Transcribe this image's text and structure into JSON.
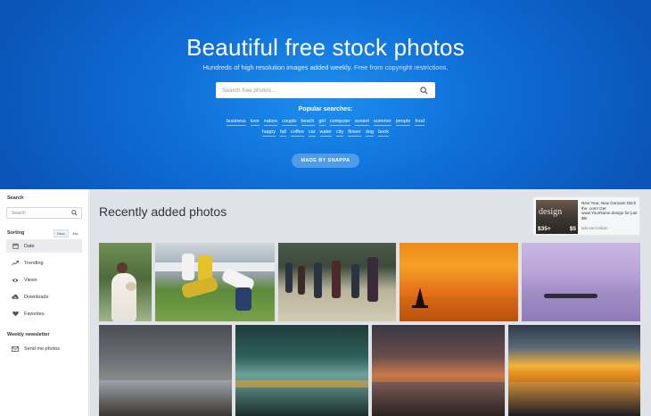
{
  "hero": {
    "title": "Beautiful free stock photos",
    "subtitle_text": "Hundreds of high resolution images added weekly. ",
    "subtitle_link": "Free from copyright restrictions.",
    "search_placeholder": "Search free photos...",
    "popular_title": "Popular searches:",
    "popular_row1": [
      "business",
      "love",
      "nature",
      "couple",
      "beach",
      "girl",
      "computer",
      "sunset",
      "summer",
      "people",
      "food"
    ],
    "popular_row2": [
      "happy",
      "fall",
      "coffee",
      "car",
      "water",
      "city",
      "flower",
      "dog",
      "book"
    ],
    "button_label": "MADE BY SNAPPA",
    "bg_color": "#0f6fd8"
  },
  "sidebar": {
    "search_title": "Search",
    "search_placeholder": "Search",
    "sorting_title": "Sorting",
    "sort_desc": "Desc",
    "sort_asc": "Asc",
    "items": [
      {
        "label": "Date",
        "icon": "calendar-icon",
        "active": true
      },
      {
        "label": "Trending",
        "icon": "trending-icon",
        "active": false
      },
      {
        "label": "Views",
        "icon": "eye-icon",
        "active": false
      },
      {
        "label": "Downloads",
        "icon": "download-icon",
        "active": false
      },
      {
        "label": "Favorites",
        "icon": "heart-icon",
        "active": false
      }
    ],
    "newsletter_title": "Weekly newsletter",
    "newsletter_item": {
      "label": "Send me photos",
      "icon": "envelope-icon"
    }
  },
  "main": {
    "section_title": "Recently added photos",
    "ad": {
      "image_word": "design",
      "price_left": "$35+",
      "price_right": "$5",
      "text": "New Year, New Domain! Ditch the .com! Get www.YourName.design for just $5!",
      "via": "ads via Carbon"
    },
    "photos": [
      {
        "subject": "bride-with-bouquet"
      },
      {
        "subject": "rugby-tackle"
      },
      {
        "subject": "rugby-team-field"
      },
      {
        "subject": "sailboat-sunset"
      },
      {
        "subject": "purple-sea-island"
      },
      {
        "subject": "stormy-beach"
      },
      {
        "subject": "teal-sky-sea"
      },
      {
        "subject": "cloudy-sunset-sea"
      },
      {
        "subject": "golden-sunset-waves"
      }
    ]
  }
}
